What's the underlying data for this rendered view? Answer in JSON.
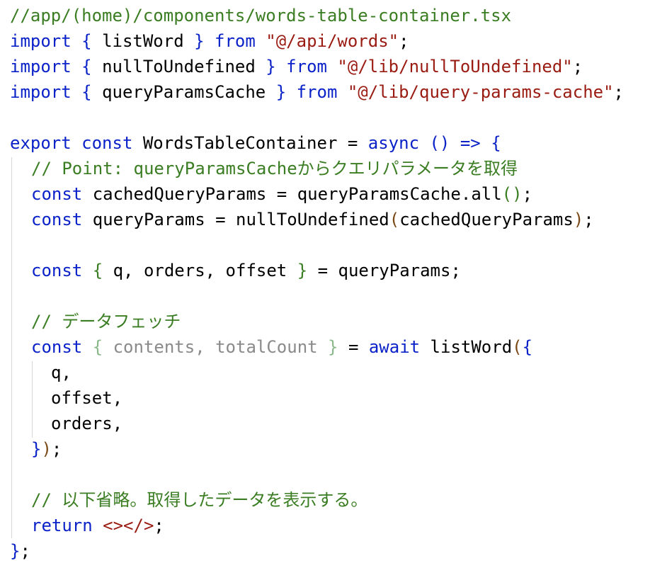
{
  "file_comment": "//app/(home)/components/words-table-container.tsx",
  "imports": [
    {
      "kw": "import",
      "ob": "{",
      "name": "listWord",
      "cb": "}",
      "from": "from",
      "path": "\"@/api/words\"",
      "end": ";"
    },
    {
      "kw": "import",
      "ob": "{",
      "name": "nullToUndefined",
      "cb": "}",
      "from": "from",
      "path": "\"@/lib/nullToUndefined\"",
      "end": ";"
    },
    {
      "kw": "import",
      "ob": "{",
      "name": "queryParamsCache",
      "cb": "}",
      "from": "from",
      "path": "\"@/lib/query-params-cache\"",
      "end": ";"
    }
  ],
  "export_line": {
    "kw1": "export",
    "kw2": "const",
    "name": "WordsTableContainer",
    "eq": "=",
    "async": "async",
    "paren": "()",
    "arrow": "=>",
    "brace": "{"
  },
  "comment_point": "// Point: queryParamsCacheからクエリパラメータを取得",
  "line_cached": {
    "kw": "const",
    "rest1": "cachedQueryParams = queryParamsCache.all",
    "paren": "()",
    "end": ";"
  },
  "line_params": {
    "kw": "const",
    "rest1": "queryParams = nullToUndefined",
    "op": "(",
    "arg": "cachedQueryParams",
    "cp": ")",
    "end": ";"
  },
  "line_destructure": {
    "kw": "const",
    "ob": "{",
    "vars": " q, orders, offset ",
    "cb": "}",
    "rest": " = queryParams;"
  },
  "comment_fetch": "// データフェッチ",
  "line_fetch": {
    "kw": "const",
    "ob": "{",
    "vars": " contents, totalCount ",
    "cb": "}",
    "eq": " = ",
    "await": "await",
    "fn": " listWord",
    "op": "(",
    "obj": "{"
  },
  "fetch_args": [
    "q,",
    "offset,",
    "orders,"
  ],
  "fetch_close": {
    "cb": "}",
    "cp": ")",
    "end": ";"
  },
  "comment_rest": "// 以下省略。取得したデータを表示する。",
  "line_return": {
    "kw": "return",
    "frag": "<></>",
    "end": ";"
  },
  "closing": {
    "brace": "}",
    "end": ";"
  }
}
